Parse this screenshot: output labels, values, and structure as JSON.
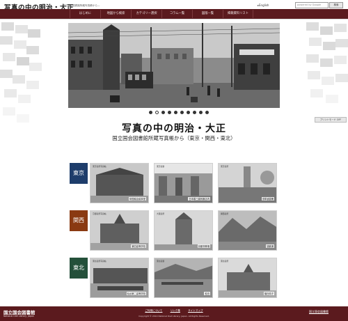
{
  "header": {
    "site_title": "写真の中の明治・大正",
    "site_subtitle": "—国立国会図書館所蔵写真帳から—",
    "lang_link": "▸English",
    "search_placeholder": "powered by Google",
    "search_button": "検索"
  },
  "nav": {
    "items": [
      "はじめに",
      "地図から検索",
      "カテゴリー選択",
      "コラム一覧",
      "図版一覧",
      "掲載資料リスト"
    ]
  },
  "side": {
    "pm_button": "プリントモード OFF"
  },
  "hero": {
    "slide_count": 10,
    "active_index": 0
  },
  "main": {
    "title": "写真の中の明治・大正",
    "subtitle": "国立国会図書館所蔵写真帳から（東京・関西・東北）"
  },
  "categories": [
    {
      "name": "東京",
      "color": "#1e3d6b",
      "photos": [
        {
          "top_label": "東京名所写真帖",
          "caption": "帝国議会議事堂"
        },
        {
          "top_label": "東京名勝",
          "caption": "日本橋三越呉服店内"
        },
        {
          "top_label": "東京名所",
          "caption": "浅草凌雲閣"
        }
      ]
    },
    {
      "name": "関西",
      "color": "#8a3a12",
      "photos": [
        {
          "top_label": "京都名所写真帖",
          "caption": "第四高等学校"
        },
        {
          "top_label": "大阪名所",
          "caption": "京都停車場"
        },
        {
          "top_label": "関西名所",
          "caption": "須磨浦"
        }
      ]
    },
    {
      "name": "東北",
      "color": "#24503a",
      "photos": [
        {
          "top_label": "東北名所写真帖",
          "caption": "仙台第二高等学校"
        },
        {
          "top_label": "東北名勝",
          "caption": "松島"
        },
        {
          "top_label": "東北名所",
          "caption": "福島県庁"
        }
      ]
    }
  ],
  "footer": {
    "ndl_logo": "国立国会図書館",
    "ndl_sub": "National Diet Library, Japan",
    "links": [
      "ご利用について",
      "リンク集",
      "サイトマップ"
    ],
    "copyright": "Copyright © 2014 National Diet Library, Japan. All Rights Reserved.",
    "ndl_top": "国立国会図書館"
  }
}
